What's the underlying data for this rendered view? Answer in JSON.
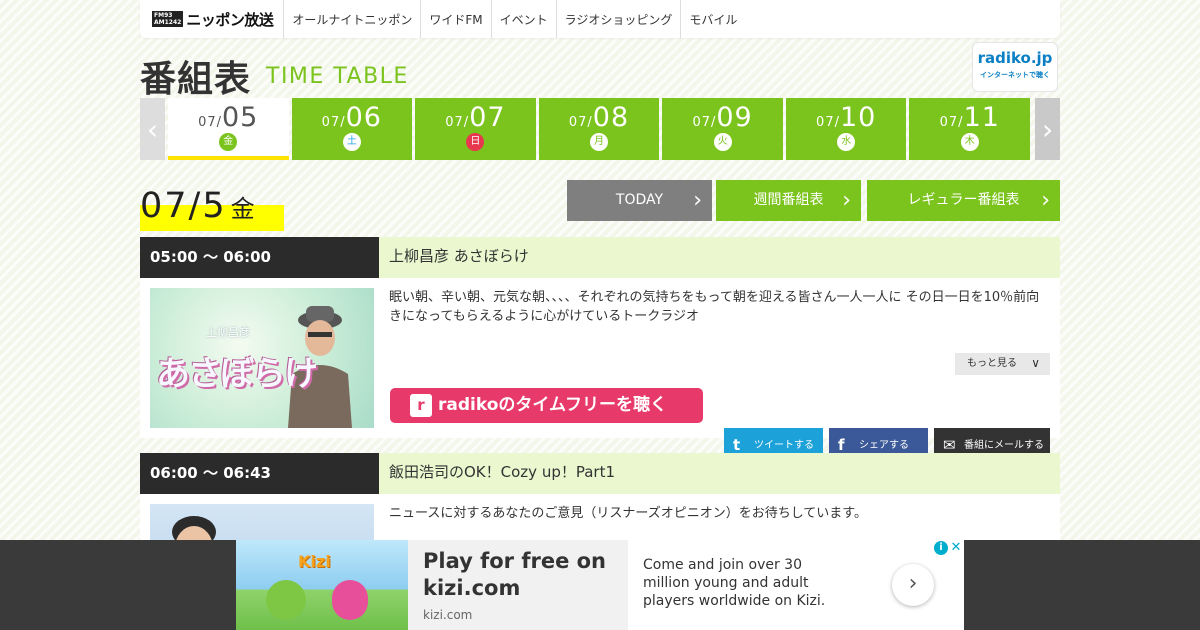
{
  "logo": {
    "freq_top": "FM93",
    "freq_bottom": "AM1242",
    "name": "ニッポン放送"
  },
  "nav": [
    {
      "label": "オールナイトニッポン"
    },
    {
      "label": "ワイドFM"
    },
    {
      "label": "イベント"
    },
    {
      "label": "ラジオショッピング"
    },
    {
      "label": "モバイル"
    }
  ],
  "title": {
    "ja": "番組表",
    "en": "TIME TABLE"
  },
  "radiko_badge": {
    "line1": "radiko.jp",
    "line2": "インターネットで聴く"
  },
  "arrows": {
    "prev": "‹",
    "next": "›"
  },
  "dates": [
    {
      "month": "07/",
      "day": "05",
      "weekday": "金"
    },
    {
      "month": "07/",
      "day": "06",
      "weekday": "土"
    },
    {
      "month": "07/",
      "day": "07",
      "weekday": "日"
    },
    {
      "month": "07/",
      "day": "08",
      "weekday": "月"
    },
    {
      "month": "07/",
      "day": "09",
      "weekday": "火"
    },
    {
      "month": "07/",
      "day": "10",
      "weekday": "水"
    },
    {
      "month": "07/",
      "day": "11",
      "weekday": "木"
    }
  ],
  "day_head": {
    "date": "07/5",
    "weekday": "金"
  },
  "actions": {
    "today": "TODAY",
    "weekly": "週間番組表",
    "regular": "レギュラー番組表",
    "chevron": "›"
  },
  "programs": [
    {
      "time": "05:00 ～ 06:00",
      "title": "上柳昌彦 あさぼらけ",
      "thumb_sub": "上柳昌彦",
      "thumb_main": "あさぼらけ",
      "description": "眠い朝、辛い朝、元気な朝、、、、それぞれの気持ちをもって朝を迎える皆さん一人一人に その日一日を10％前向きになってもらえるように心がけているトークラジオ",
      "more": "もっと見る",
      "more_icon": "∨",
      "radiko": "radikoのタイムフリーを聴く",
      "radiko_icon": "r",
      "tweet": "ツイートする",
      "share": "シェアする",
      "mail": "番組にメールする",
      "tw_icon": "t",
      "fb_icon": "f",
      "mail_icon": "✉"
    },
    {
      "time": "06:00 ～ 06:43",
      "title": "飯田浩司のOK！Cozy up！Part1",
      "description": "ニュースに対するあなたのご意見（リスナーズオピニオン）をお待ちしています。"
    }
  ],
  "ad": {
    "brand": "Kizi",
    "title": "Play for free on kizi.com",
    "domain": "kizi.com",
    "body": "Come and join over 30 million young and adult players worldwide on Kizi.",
    "go": "›",
    "info": "i",
    "close": "✕"
  }
}
